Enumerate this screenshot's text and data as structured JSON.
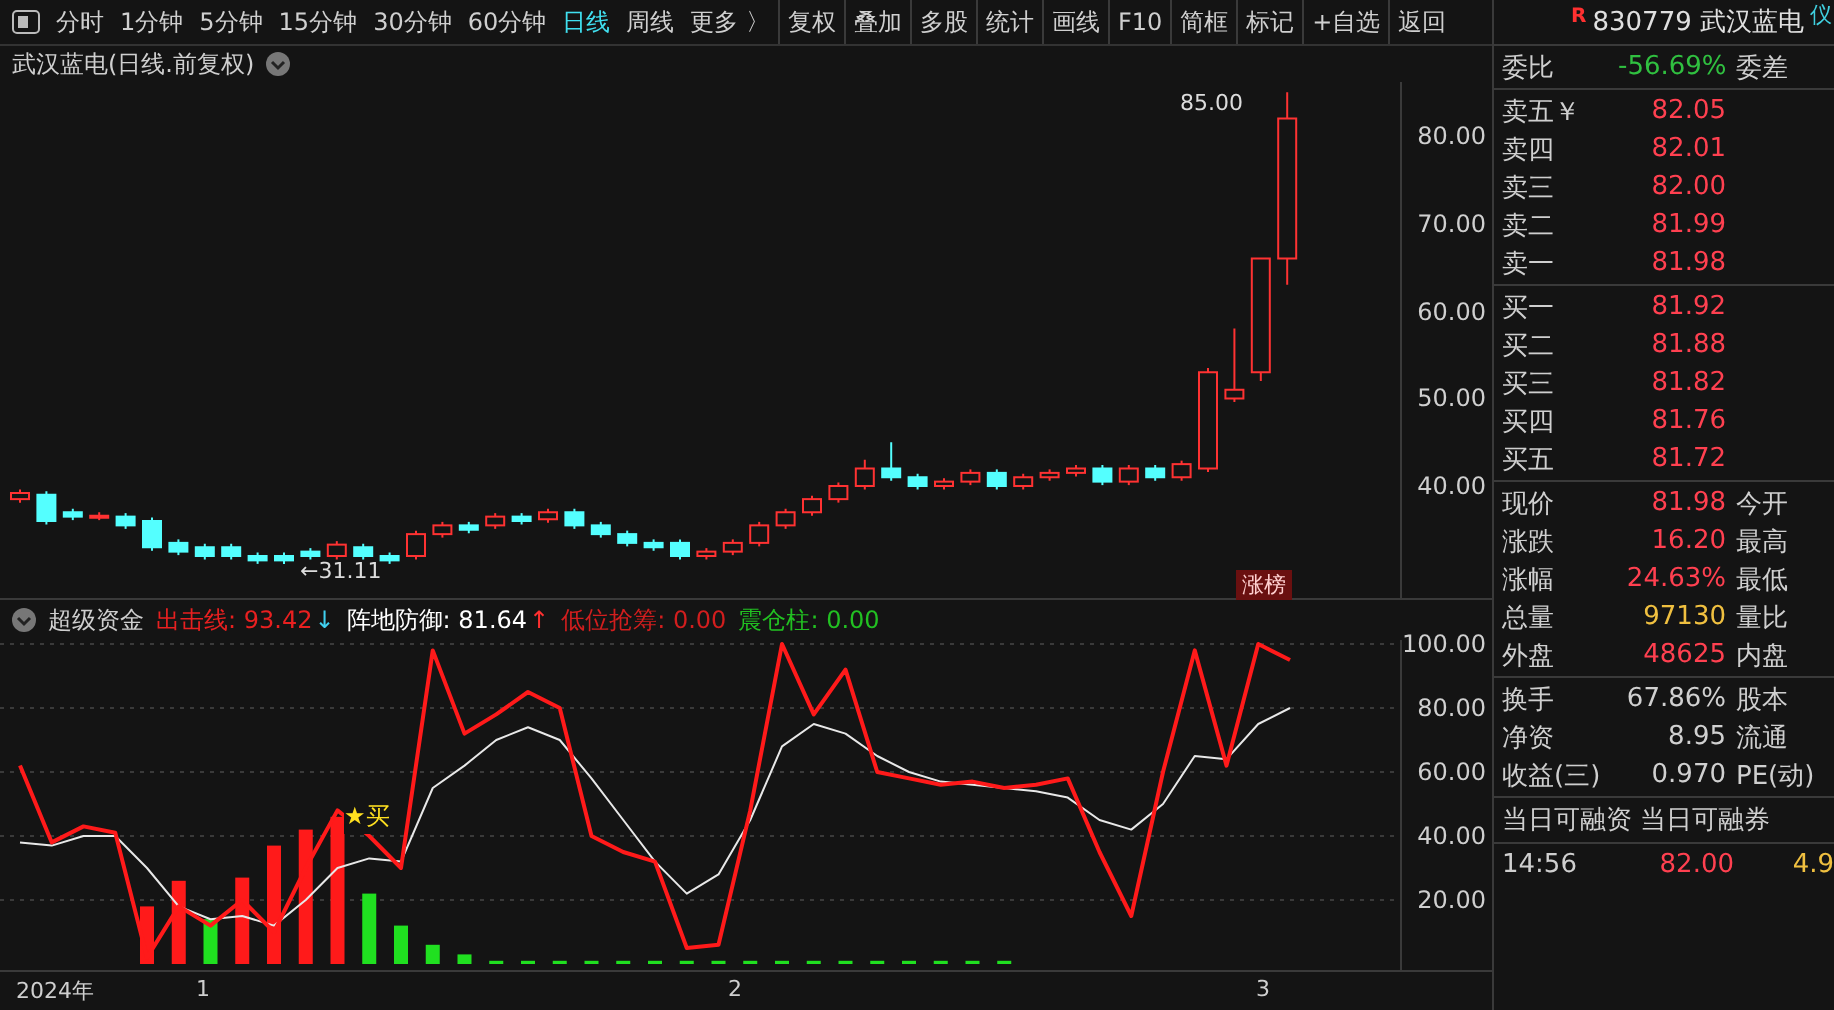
{
  "toolbar": {
    "tabs": [
      {
        "label": "分时",
        "selected": false
      },
      {
        "label": "1分钟",
        "selected": false
      },
      {
        "label": "5分钟",
        "selected": false
      },
      {
        "label": "15分钟",
        "selected": false
      },
      {
        "label": "30分钟",
        "selected": false
      },
      {
        "label": "60分钟",
        "selected": false
      },
      {
        "label": "日线",
        "selected": true
      },
      {
        "label": "周线",
        "selected": false
      },
      {
        "label": "更多 〉",
        "selected": false
      }
    ],
    "buttons": [
      "复权",
      "叠加",
      "多股",
      "统计",
      "画线",
      "F10",
      "简框",
      "标记",
      "+自选",
      "返回"
    ]
  },
  "chart_title": "武汉蓝电(日线.前复权)",
  "price_chart": {
    "y_labels": [
      "80.00",
      "70.00",
      "60.00",
      "50.00",
      "40.00"
    ],
    "annotations": [
      {
        "kind": "high",
        "text": "85.00"
      },
      {
        "kind": "low",
        "text": "←31.11"
      },
      {
        "kind": "badge",
        "text": "涨榜"
      }
    ]
  },
  "indicator": {
    "name": "超级资金",
    "legend": [
      {
        "label": "出击线:",
        "value": "93.42",
        "arrow": {
          "text": "↓",
          "color": "#40d0f0"
        },
        "color": "#e82020"
      },
      {
        "label": "阵地防御:",
        "value": "81.64",
        "arrow": {
          "text": "↑",
          "color": "#ff3030"
        },
        "color": "#ffffff"
      },
      {
        "label": "低位抢筹:",
        "value": "0.00",
        "color": "#d21e1e"
      },
      {
        "label": "震仓柱:",
        "value": "0.00",
        "color": "#22c022"
      }
    ],
    "signal": "★买",
    "chart_data": {
      "type": "line",
      "grid": true,
      "ylim": [
        0,
        100
      ],
      "yticks": [
        {
          "value": 100,
          "label": "100.00"
        },
        {
          "value": 80,
          "label": "80.00"
        },
        {
          "value": 60,
          "label": "60.00"
        },
        {
          "value": 40,
          "label": "40.00"
        },
        {
          "value": 20,
          "label": "20.00"
        }
      ],
      "series": [
        {
          "type": "bar",
          "color": "#ff1a1a",
          "values": [
            null,
            null,
            null,
            null,
            18,
            26,
            null,
            27,
            37,
            42,
            46,
            null,
            null,
            null,
            null,
            null,
            null,
            null,
            null,
            null,
            null,
            null,
            null,
            null,
            null,
            null,
            null,
            null,
            null,
            null,
            null,
            null,
            null,
            null,
            null,
            null,
            null,
            null,
            null,
            null,
            null
          ]
        },
        {
          "type": "bar",
          "color": "#20e020",
          "values": [
            null,
            null,
            null,
            null,
            null,
            null,
            14,
            null,
            null,
            null,
            null,
            22,
            12,
            6,
            3,
            1,
            1,
            1,
            1,
            1,
            1,
            1,
            1,
            1,
            1,
            1,
            1,
            1,
            1,
            1,
            1,
            1,
            null,
            null,
            null,
            null,
            null,
            null,
            null,
            null,
            null
          ]
        },
        {
          "type": "line",
          "color": "#ff1a1a",
          "values": [
            62,
            38,
            43,
            41,
            2,
            18,
            12,
            20,
            10,
            30,
            48,
            40,
            30,
            98,
            72,
            78,
            85,
            80,
            40,
            35,
            32,
            5,
            6,
            48,
            100,
            78,
            92,
            60,
            58,
            56,
            57,
            55,
            56,
            58,
            35,
            15,
            60,
            98,
            62,
            100,
            95
          ]
        },
        {
          "type": "line",
          "color": "#e8e8e8",
          "values": [
            38,
            37,
            40,
            40,
            30,
            18,
            14,
            15,
            12,
            20,
            30,
            33,
            32,
            55,
            62,
            70,
            74,
            70,
            58,
            45,
            32,
            22,
            28,
            45,
            68,
            75,
            72,
            65,
            60,
            57,
            56,
            55,
            54,
            52,
            45,
            42,
            50,
            65,
            64,
            75,
            80
          ]
        }
      ]
    }
  },
  "date_axis": [
    "2024年",
    "1",
    "2",
    "3"
  ],
  "quote": {
    "badge": "R",
    "title": "830779 武汉蓝电",
    "edge": "仪",
    "ratio": {
      "label": "委比",
      "value": "-56.69%",
      "right": "委差"
    },
    "asks": [
      {
        "label": "卖五￥",
        "price": "82.05"
      },
      {
        "label": "卖四",
        "price": "82.01"
      },
      {
        "label": "卖三",
        "price": "82.00"
      },
      {
        "label": "卖二",
        "price": "81.99"
      },
      {
        "label": "卖一",
        "price": "81.98"
      }
    ],
    "bids": [
      {
        "label": "买一",
        "price": "81.92"
      },
      {
        "label": "买二",
        "price": "81.88"
      },
      {
        "label": "买三",
        "price": "81.82"
      },
      {
        "label": "买四",
        "price": "81.76"
      },
      {
        "label": "买五",
        "price": "81.72"
      }
    ],
    "stats": [
      {
        "label": "现价",
        "value": "81.98",
        "color": "#ff4050",
        "right": "今开"
      },
      {
        "label": "涨跌",
        "value": "16.20",
        "color": "#ff4050",
        "right": "最高"
      },
      {
        "label": "涨幅",
        "value": "24.63%",
        "color": "#ff4050",
        "right": "最低"
      },
      {
        "label": "总量",
        "value": "97130",
        "color": "#f0c040",
        "right": "量比"
      },
      {
        "label": "外盘",
        "value": "48625",
        "color": "#ff4050",
        "right": "内盘"
      }
    ],
    "stats2": [
      {
        "label": "换手",
        "value": "67.86%",
        "color": "#d0d0d0",
        "right": "股本"
      },
      {
        "label": "净资",
        "value": "8.95",
        "color": "#d0d0d0",
        "right": "流通"
      },
      {
        "label": "收益(三)",
        "value": "0.970",
        "color": "#d0d0d0",
        "right": "PE(动)"
      }
    ],
    "margin": [
      "当日可融资",
      "当日可融券"
    ],
    "trades": [
      {
        "time": "14:56",
        "price": "82.00",
        "volume": "4.9"
      }
    ]
  }
}
